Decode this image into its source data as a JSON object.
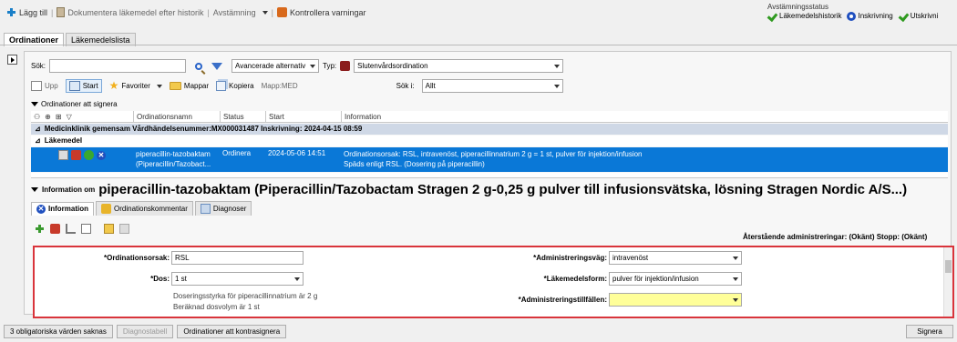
{
  "toolbar": {
    "add": "Lägg till",
    "document_history": "Dokumentera läkemedel efter historik",
    "reconciliation": "Avstämning",
    "check_warnings": "Kontrollera varningar"
  },
  "reconciliation_status": {
    "title": "Avstämningsstatus",
    "items": [
      "Läkemedelshistorik",
      "Inskrivning",
      "Utskrivni"
    ]
  },
  "tabs": [
    "Ordinationer",
    "Läkemedelslista"
  ],
  "search": {
    "label": "Sök:",
    "value": "",
    "advanced": "Avancerade alternativ",
    "type_label": "Typ:",
    "type_value": "Slutenvårdsordination"
  },
  "nav": {
    "up": "Upp",
    "start": "Start",
    "favorites": "Favoriter",
    "folders": "Mappar",
    "copy": "Kopiera",
    "folder_name": "Mapp:MED",
    "search_in_label": "Sök i:",
    "search_in_value": "Allt"
  },
  "list": {
    "section_title": "Ordinationer att signera",
    "columns": [
      "Ordinationsnamn",
      "Status",
      "Start",
      "Information"
    ],
    "group1": "Medicinklinik gemensam  Vårdhändelsenummer:MX000031487  Inskrivning: 2024-04-15 08:59",
    "group2": "Läkemedel",
    "row": {
      "name1": "piperacillin-tazobaktam",
      "name2": "(Piperacillin/Tazobact...",
      "status": "Ordinera",
      "start": "2024-05-06 14:51",
      "info1": "Ordinationsorsak: RSL, intravenöst, piperacillinnatrium 2 g = 1 st, pulver för injektion/infusion",
      "info2": "Späds enligt RSL. (Dosering på piperacillin)"
    }
  },
  "info": {
    "prefix": "Information om",
    "title": "piperacillin-tazobaktam (Piperacillin/Tazobactam Stragen 2 g-0,25 g pulver till infusionsvätska, lösning Stragen Nordic A/S...)",
    "tabs": [
      "Information",
      "Ordinationskommentar",
      "Diagnoser"
    ],
    "remaining": "Återstående administreringar: (Okänt)  Stopp: (Okänt)"
  },
  "form": {
    "reason_label": "*Ordinationsorsak:",
    "reason_value": "RSL",
    "dose_label": "*Dos:",
    "dose_value": "1 st",
    "dose_note1": "Doseringsstyrka för piperacillinnatrium är 2 g",
    "dose_note2": "Beräknad dosvolym är 1 st",
    "route_label": "*Administreringsväg:",
    "route_value": "intravenöst",
    "form_label": "*Läkemedelsform:",
    "form_value": "pulver för injektion/infusion",
    "occasions_label": "*Administreringstillfällen:",
    "occasions_value": ""
  },
  "footer": {
    "missing": "3 obligatoriska värden saknas",
    "diag_table": "Diagnostabell",
    "cosign": "Ordinationer att kontrasignera",
    "sign": "Signera"
  },
  "colors": {
    "selected_row": "#0a78d7",
    "highlight_field": "#ffff99",
    "error_border": "#d9343b"
  }
}
